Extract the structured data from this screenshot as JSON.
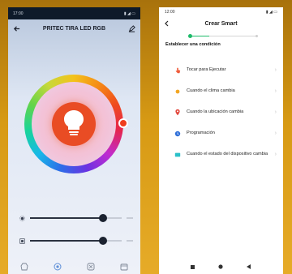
{
  "left_screen": {
    "status_bar": {
      "time": "17:00"
    },
    "title": "PRITEC TIRA LED RGB",
    "colors": {
      "bulb": "#e94c24",
      "knob": "#ef3d1c"
    },
    "sliders": [
      {
        "icon": "brightness-icon",
        "value": 0.8
      },
      {
        "icon": "temperature-icon",
        "value": 0.8
      }
    ],
    "bottom_nav": [
      "color-mode-icon",
      "palette-icon",
      "scene-icon",
      "schedule-icon"
    ]
  },
  "right_screen": {
    "status_bar": {
      "time": "12:00"
    },
    "title": "Crear Smart",
    "section_label": "Establecer una condición",
    "conditions": [
      {
        "label": "Tocar para Ejecutar",
        "icon": "tap-icon",
        "color": "#ef5b3a"
      },
      {
        "label": "Cuando el clima cambia",
        "icon": "weather-icon",
        "color": "#f2a623"
      },
      {
        "label": "Cuando la ubicación cambia",
        "icon": "location-icon",
        "color": "#e2453a"
      },
      {
        "label": "Programación",
        "icon": "clock-icon",
        "color": "#2f6fd8"
      },
      {
        "label": "Cuando el estado del dispositivo cambia",
        "icon": "device-icon",
        "color": "#2bc0c9"
      }
    ],
    "accent": "#1eba6a"
  }
}
